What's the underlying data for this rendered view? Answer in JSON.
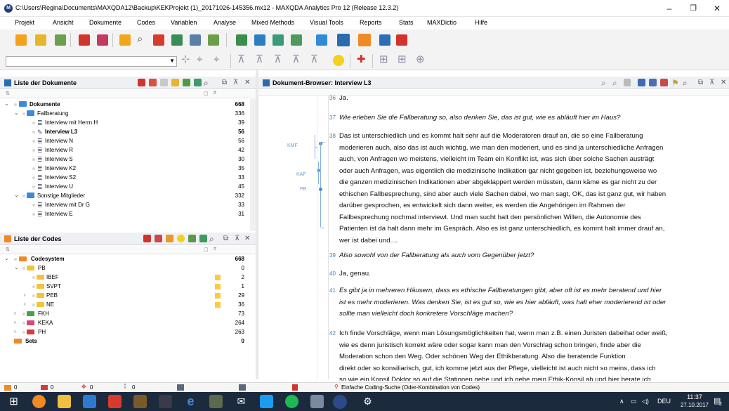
{
  "window": {
    "title": "C:\\Users\\Regina\\Documents\\MAXQDA12\\Backup\\KEKProjekt (1)_20171026-145356.mx12 - MAXQDA Analytics Pro 12 (Release 12.3.2)",
    "minimize": "–",
    "maximize": "❐",
    "close": "✕"
  },
  "menu": [
    "Projekt",
    "Ansicht",
    "Dokumente",
    "Codes",
    "Variablen",
    "Analyse",
    "Mixed Methods",
    "Visual Tools",
    "Reports",
    "Stats",
    "MAXDictio",
    "Hilfe"
  ],
  "doc_panel": {
    "title": "Liste der Dokumente",
    "col_hash": "#",
    "rows": [
      {
        "label": "Dokumente",
        "count": "668",
        "bold": true
      },
      {
        "label": "Fallberatung",
        "count": "336"
      },
      {
        "label": "Interview mit Herrn H",
        "count": "39"
      },
      {
        "label": "Interview L3",
        "count": "56",
        "bold": true
      },
      {
        "label": "Interview N",
        "count": "56"
      },
      {
        "label": "Interview R",
        "count": "42"
      },
      {
        "label": "Interview S",
        "count": "30"
      },
      {
        "label": "Interview K2",
        "count": "35"
      },
      {
        "label": "Interview S2",
        "count": "33"
      },
      {
        "label": "Interview U",
        "count": "45"
      },
      {
        "label": "Sonstige Mitglieder",
        "count": "332"
      },
      {
        "label": "Interview mit Dr G",
        "count": "33"
      },
      {
        "label": "Interview E",
        "count": "31"
      }
    ]
  },
  "code_panel": {
    "title": "Liste der Codes",
    "col_hash": "#",
    "rows": [
      {
        "label": "Codesystem",
        "count": "668",
        "bold": true
      },
      {
        "label": "PB",
        "count": "0"
      },
      {
        "label": "IBEF",
        "count": "2"
      },
      {
        "label": "SVPT",
        "count": "1"
      },
      {
        "label": "PEB",
        "count": "29"
      },
      {
        "label": "NE",
        "count": "36"
      },
      {
        "label": "FKH",
        "count": "73"
      },
      {
        "label": "KEKA",
        "count": "264"
      },
      {
        "label": "PH",
        "count": "263"
      },
      {
        "label": "Sets",
        "count": "0",
        "bold": true
      }
    ]
  },
  "browser": {
    "title": "Dokument-Browser: Interview L3",
    "margin_codes": [
      "KMF",
      "KAF",
      "PB"
    ],
    "paragraphs": [
      {
        "num": "36",
        "italic": false,
        "lines": [
          "Ja."
        ]
      },
      {
        "num": "37",
        "italic": true,
        "lines": [
          "Wie erleben Sie die Fallberatung so, also denken Sie, das ist gut, wie es abläuft hier im Haus?"
        ]
      },
      {
        "num": "38",
        "italic": false,
        "lines": [
          "Das ist unterschiedlich und es kommt halt sehr auf die Moderatoren drauf an, die so eine Fallberatung",
          "moderieren auch, also das ist auch wichtig, wie man den moderiert, und es sind ja unterschiedliche Anfragen",
          "auch, von Anfragen wo meistens, vielleicht im Team ein Konflikt ist, was sich über solche Sachen austrägt",
          "oder auch Anfragen, was eigentlich die medizinische Indikation gar nicht gegeben ist, beziehungsweise wo",
          "die ganzen medizinischen Indikationen aber abgeklappert werden müssten, dann käme es gar nicht zu der",
          "ethischen Fallbesprechung, sind aber auch viele Sachen dabei, wo man sagt, OK, das ist ganz gut, wir haben",
          "darüber gesprochen, es entwickelt sich dann weiter, es werden die Angehörigen im Rahmen der",
          "Fallbesprechung nochmal interviewt. Und man sucht halt den persönlichen Willen, die Autonomie des",
          "Patienten ist da halt dann mehr im Gespräch. Also es ist ganz unterschiedlich, es kommt halt immer drauf an,",
          "wer ist dabei und...."
        ]
      },
      {
        "num": "39",
        "italic": true,
        "lines": [
          "Also sowohl von der Fallberatung als auch vom Gegenüber jetzt?"
        ]
      },
      {
        "num": "40",
        "italic": false,
        "lines": [
          "Ja, genau."
        ]
      },
      {
        "num": "41",
        "italic": true,
        "lines": [
          "Es gibt ja in mehreren Häusern, dass es ethische Fallberatungen gibt, aber oft ist es mehr beratend und hier",
          "ist es mehr moderieren. Was denken Sie, ist es gut so, wie es hier abläuft, was halt eher moderierend ist oder",
          "sollte man vielleicht doch konkretere Vorschläge machen?"
        ]
      },
      {
        "num": "42",
        "italic": false,
        "lines": [
          "Ich finde Vorschläge, wenn man Lösungsmöglichkeiten hat, wenn man z.B. einen Juristen dabeihat oder weiß,",
          "wie es denn juristisch korrekt wäre oder sogar kann man den Vorschlag schon bringen, finde aber die",
          "Moderation schon den Weg. Oder schönen Weg der Ethikberatung. Also die beratende Funktion",
          "direkt oder so konsiliarisch, gut, ich komme jetzt aus der Pflege, vielleicht ist auch nicht so meins, dass ich",
          "so wie ein Konsil Doktor so auf die Stationen gehe und ich gebe mein Ethik-Konsil ab und hier berate ich."
        ]
      }
    ]
  },
  "status": {
    "items": [
      "0",
      "0",
      "0",
      "0"
    ],
    "search": "Einfache Coding-Suche (Oder-Kombination von Codes)"
  },
  "taskbar": {
    "lang": "DEU",
    "time": "11:37",
    "date": "27.10.2017",
    "notif": "2"
  }
}
